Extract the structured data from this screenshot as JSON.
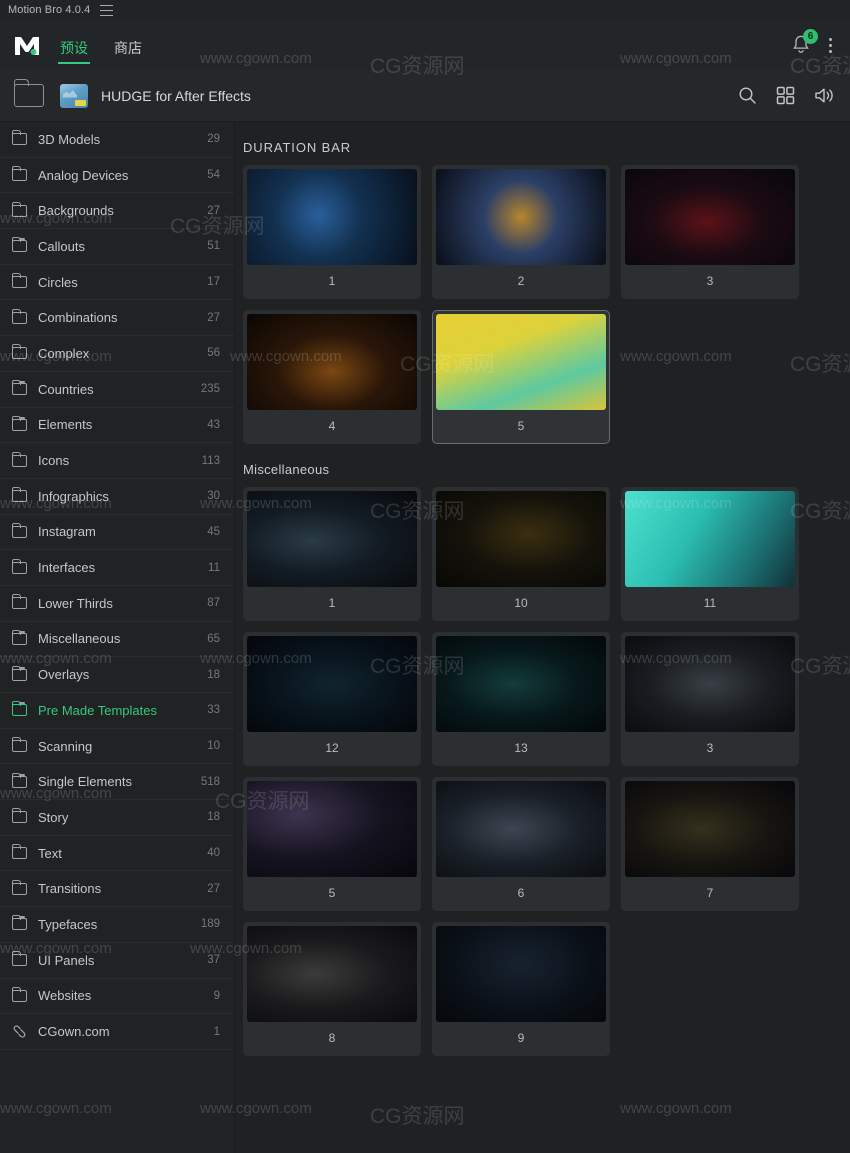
{
  "titlebar": {
    "app_title": "Motion Bro 4.0.4",
    "menu_icon": "hamburger-icon"
  },
  "header": {
    "logo": "motion-bro-logo",
    "tabs": [
      {
        "label": "预设",
        "active": true
      },
      {
        "label": "商店",
        "active": false
      }
    ],
    "notification_badge": "6",
    "accent_color": "#35c97e"
  },
  "breadcrumb": {
    "back_icon": "folder-up-icon",
    "pack_title": "HUDGE for After Effects",
    "actions": [
      "search-icon",
      "grid-view-icon",
      "sound-icon"
    ]
  },
  "sidebar": {
    "items": [
      {
        "label": "3D Models",
        "count": "29",
        "icon": "folder-icon",
        "active": false
      },
      {
        "label": "Analog Devices",
        "count": "54",
        "icon": "folder-icon",
        "active": false
      },
      {
        "label": "Backgrounds",
        "count": "27",
        "icon": "folder-icon",
        "active": false
      },
      {
        "label": "Callouts",
        "count": "51",
        "icon": "folder-open-icon",
        "active": false
      },
      {
        "label": "Circles",
        "count": "17",
        "icon": "folder-icon",
        "active": false
      },
      {
        "label": "Combinations",
        "count": "27",
        "icon": "folder-icon",
        "active": false
      },
      {
        "label": "Complex",
        "count": "56",
        "icon": "folder-icon",
        "active": false
      },
      {
        "label": "Countries",
        "count": "235",
        "icon": "folder-open-icon",
        "active": false
      },
      {
        "label": "Elements",
        "count": "43",
        "icon": "folder-open-icon",
        "active": false
      },
      {
        "label": "Icons",
        "count": "113",
        "icon": "folder-icon",
        "active": false
      },
      {
        "label": "Infographics",
        "count": "30",
        "icon": "folder-icon",
        "active": false
      },
      {
        "label": "Instagram",
        "count": "45",
        "icon": "folder-icon",
        "active": false
      },
      {
        "label": "Interfaces",
        "count": "11",
        "icon": "folder-icon",
        "active": false
      },
      {
        "label": "Lower Thirds",
        "count": "87",
        "icon": "folder-icon",
        "active": false
      },
      {
        "label": "Miscellaneous",
        "count": "65",
        "icon": "folder-open-icon",
        "active": false
      },
      {
        "label": "Overlays",
        "count": "18",
        "icon": "folder-open-icon",
        "active": false
      },
      {
        "label": "Pre Made Templates",
        "count": "33",
        "icon": "folder-open-icon",
        "active": true
      },
      {
        "label": "Scanning",
        "count": "10",
        "icon": "folder-icon",
        "active": false
      },
      {
        "label": "Single Elements",
        "count": "518",
        "icon": "folder-open-icon",
        "active": false
      },
      {
        "label": "Story",
        "count": "18",
        "icon": "folder-icon",
        "active": false
      },
      {
        "label": "Text",
        "count": "40",
        "icon": "folder-icon",
        "active": false
      },
      {
        "label": "Transitions",
        "count": "27",
        "icon": "folder-icon",
        "active": false
      },
      {
        "label": "Typefaces",
        "count": "189",
        "icon": "folder-open-icon",
        "active": false
      },
      {
        "label": "UI Panels",
        "count": "37",
        "icon": "folder-icon",
        "active": false
      },
      {
        "label": "Websites",
        "count": "9",
        "icon": "folder-icon",
        "active": false
      },
      {
        "label": "CGown.com",
        "count": "1",
        "icon": "link-icon",
        "active": false
      }
    ]
  },
  "main": {
    "sections": [
      {
        "title": "DURATION BAR",
        "uppercase": true,
        "cards": [
          {
            "label": "1",
            "selected": false,
            "art": "pm-circuit-blue"
          },
          {
            "label": "2",
            "selected": false,
            "art": "pm-chip-diamond"
          },
          {
            "label": "3",
            "selected": false,
            "art": "red-city-dark"
          },
          {
            "label": "4",
            "selected": false,
            "art": "cyberpunk-text"
          },
          {
            "label": "5",
            "selected": true,
            "art": "yellow-glitch"
          }
        ]
      },
      {
        "title": "Miscellaneous",
        "uppercase": false,
        "cards": [
          {
            "label": "1",
            "selected": false,
            "art": "hud-radar-red"
          },
          {
            "label": "10",
            "selected": false,
            "art": "gold-panels"
          },
          {
            "label": "11",
            "selected": false,
            "art": "teal-blocks"
          },
          {
            "label": "12",
            "selected": false,
            "art": "world-map"
          },
          {
            "label": "13",
            "selected": false,
            "art": "teal-grid-dark"
          },
          {
            "label": "3",
            "selected": false,
            "art": "tech-board-grey"
          },
          {
            "label": "5",
            "selected": false,
            "art": "skull-brain"
          },
          {
            "label": "6",
            "selected": false,
            "art": "glass-panels"
          },
          {
            "label": "7",
            "selected": false,
            "art": "circuit-gold-dark"
          },
          {
            "label": "8",
            "selected": false,
            "art": "sphere-scan"
          },
          {
            "label": "9",
            "selected": false,
            "art": "dark-plane"
          }
        ]
      }
    ]
  },
  "watermarks": {
    "text_a": "www.cgown.com",
    "text_b": "CG资源网"
  }
}
